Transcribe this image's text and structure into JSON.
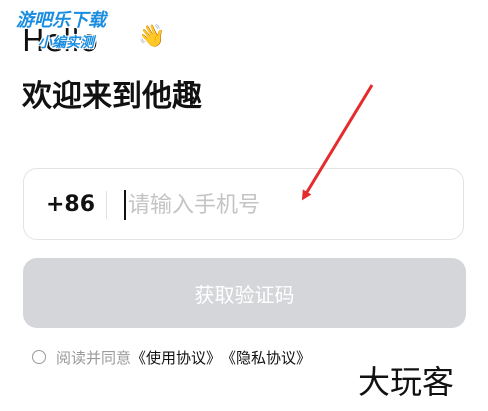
{
  "watermark_top": {
    "line1": "游吧乐下载",
    "line2": "小编实测"
  },
  "greeting": "Hello",
  "welcome": "欢迎来到他趣",
  "phone": {
    "country_code": "+86",
    "placeholder": "请输入手机号",
    "value": ""
  },
  "get_code_button": "获取验证码",
  "agreement": {
    "prefix": "阅读并同意",
    "terms_link": "《使用协议》",
    "privacy_link": "《隐私协议》"
  },
  "watermark_bottom": "大玩客",
  "colors": {
    "arrow": "#e52b2b",
    "button_disabled": "#d4d6d9",
    "watermark_blue": "#1a8de0"
  }
}
